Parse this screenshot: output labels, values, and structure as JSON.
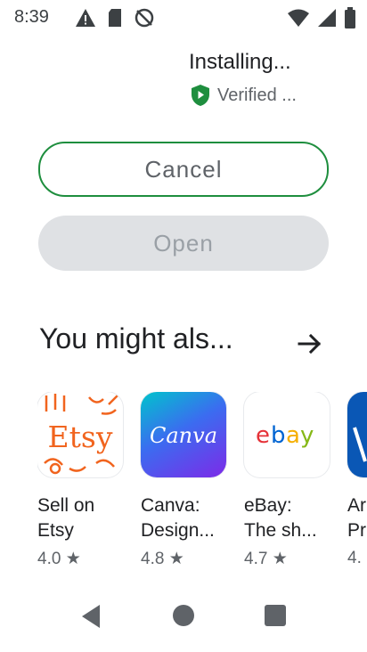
{
  "status_bar": {
    "time": "8:39"
  },
  "install": {
    "status": "Installing...",
    "verified": "Verified ..."
  },
  "buttons": {
    "cancel": "Cancel",
    "open": "Open"
  },
  "recommendations": {
    "title": "You might als...",
    "apps": [
      {
        "name_line1": "Sell on",
        "name_line2": "Etsy",
        "rating": "4.0 ★",
        "icon": "etsy-icon"
      },
      {
        "name_line1": "Canva:",
        "name_line2": "Design...",
        "rating": "4.8 ★",
        "icon": "canva-icon"
      },
      {
        "name_line1": "eBay:",
        "name_line2": "The sh...",
        "rating": "4.7 ★",
        "icon": "ebay-icon"
      },
      {
        "name_line1": "Ar",
        "name_line2": "Pr",
        "rating": "4.",
        "icon": "partial-app-icon"
      }
    ]
  },
  "colors": {
    "accent_green": "#1e8e3e",
    "etsy_orange": "#f1641e",
    "canva_gradient_start": "#7d2ae8",
    "canva_gradient_end": "#00c4cc",
    "open_disabled_bg": "#dfe1e4"
  }
}
